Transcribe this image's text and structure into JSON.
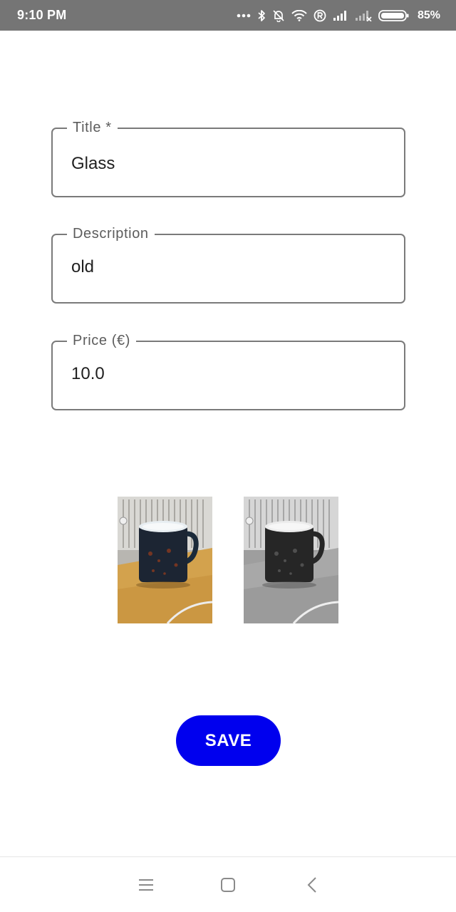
{
  "status_bar": {
    "time": "9:10 PM",
    "battery_percent": "85%",
    "icons": [
      "more-dots-icon",
      "bluetooth-icon",
      "bell-muted-icon",
      "wifi-icon",
      "registered-icon",
      "signal-icon",
      "signal-no-service-icon",
      "battery-icon"
    ]
  },
  "form": {
    "title": {
      "label": "Title *",
      "value": "Glass"
    },
    "description": {
      "label": "Description",
      "value": "old"
    },
    "price": {
      "label": "Price (€)",
      "value": "10.0"
    }
  },
  "photos": [
    {
      "name": "mug-photo-color",
      "filter": "color"
    },
    {
      "name": "mug-photo-grayscale",
      "filter": "grayscale"
    }
  ],
  "actions": {
    "save_label": "SAVE"
  },
  "colors": {
    "status_bar": "#757575",
    "accent": "#0000ee",
    "field_border": "#7a7a7a"
  },
  "nav_bar": {
    "icons": [
      "menu-icon",
      "home-icon",
      "back-icon"
    ]
  }
}
